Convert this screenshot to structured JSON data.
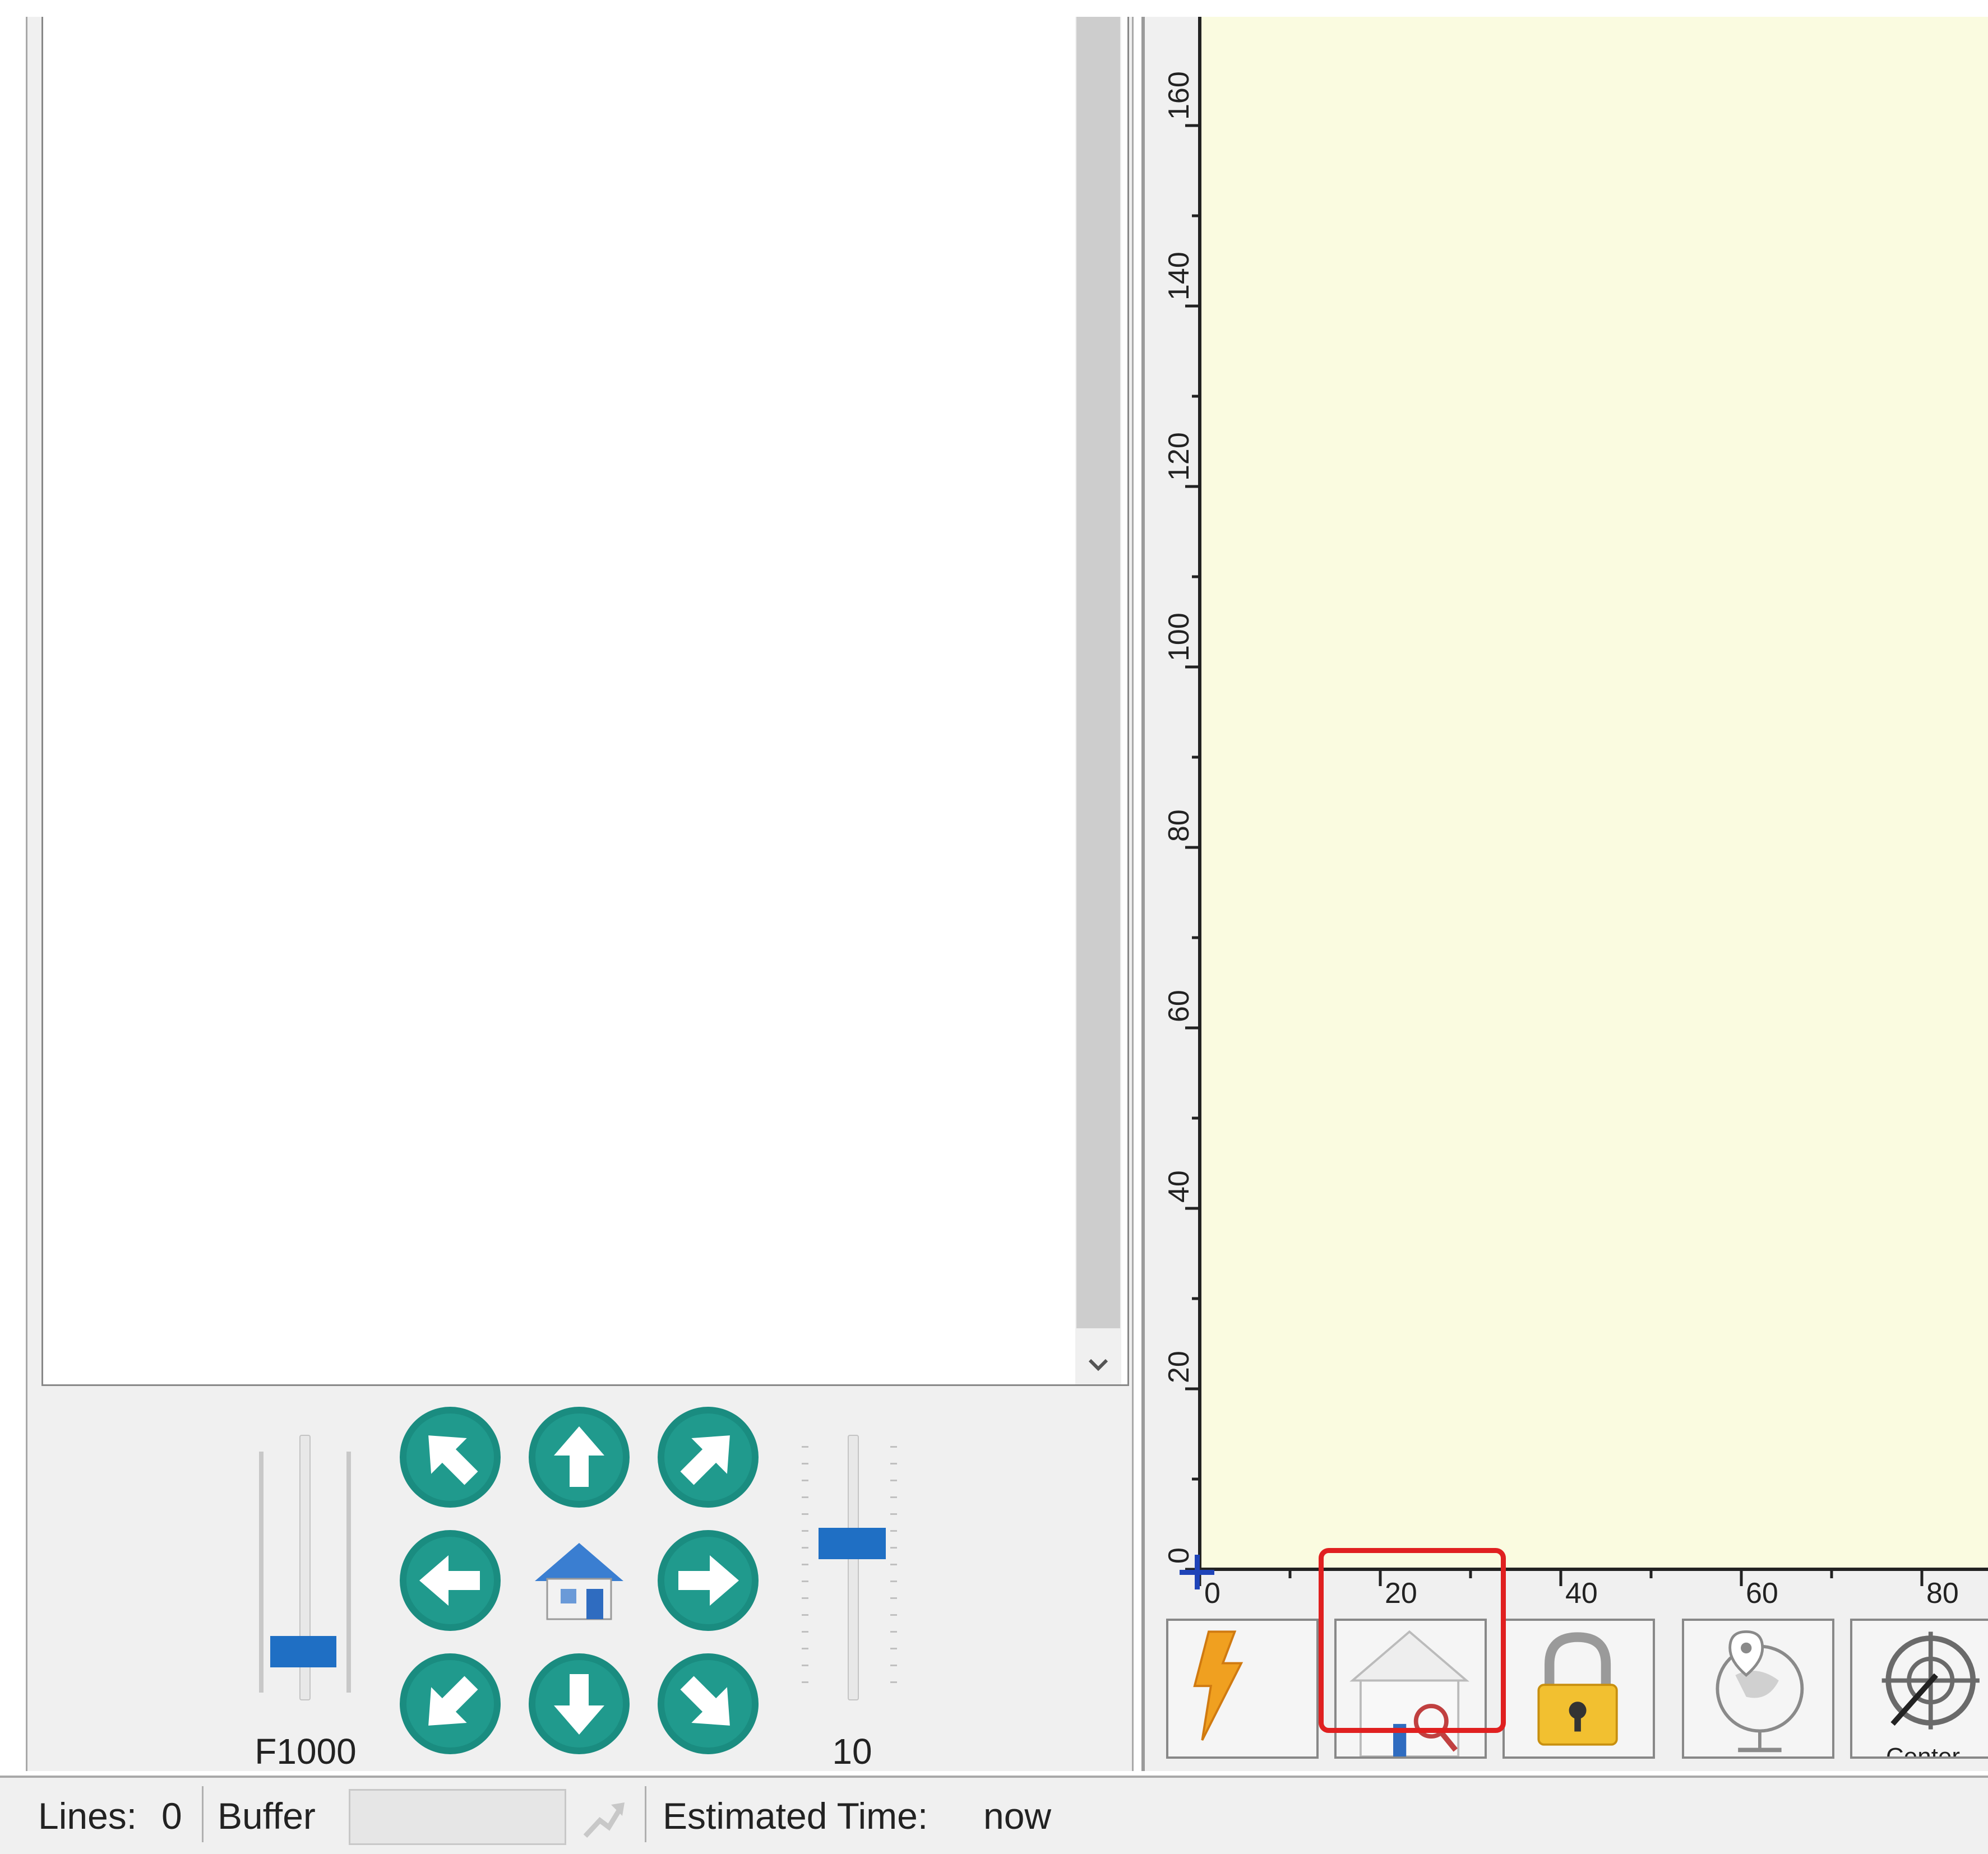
{
  "jog": {
    "feed_label": "F1000",
    "feed_slider_level": 0.12,
    "step_label": "10",
    "step_slider_level": 0.6,
    "accent_color": "#1f6fc4",
    "jog_button_color": "#1a8c80"
  },
  "canvas": {
    "background_color": "#fafbe0",
    "y_axis_ticks": [
      "0",
      "20",
      "40",
      "60",
      "80",
      "100",
      "120",
      "140",
      "160"
    ],
    "x_axis_ticks": [
      "0",
      "20",
      "40",
      "60",
      "80"
    ]
  },
  "toolbar": {
    "buttons": [
      {
        "icon": "lightning-icon"
      },
      {
        "icon": "home-search-icon"
      },
      {
        "icon": "padlock-icon"
      },
      {
        "icon": "globe-pin-icon"
      },
      {
        "icon": "center-target-icon",
        "label": "Center"
      }
    ],
    "highlight_color": "#e02020"
  },
  "status": {
    "lines_label": "Lines:",
    "lines_value": "0",
    "buffer_label": "Buffer",
    "estimated_label": "Estimated Time:",
    "estimated_value": "now"
  }
}
